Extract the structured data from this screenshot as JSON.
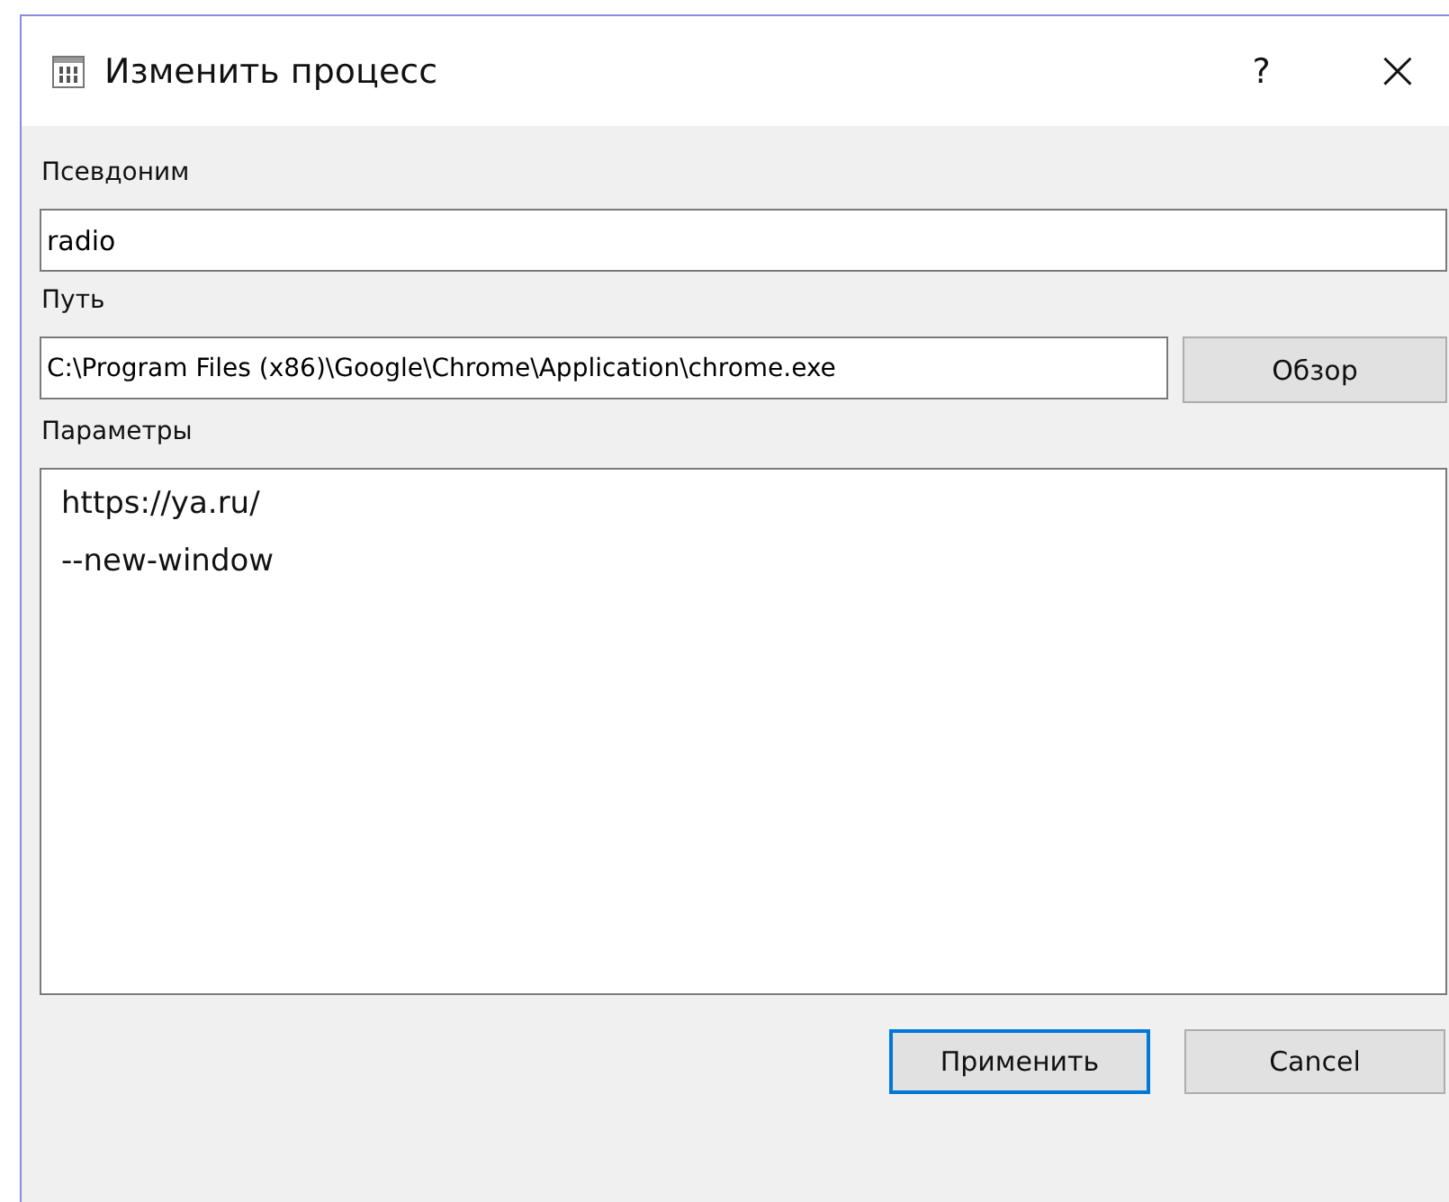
{
  "window": {
    "title": "Изменить процесс",
    "help": "?",
    "close": "×"
  },
  "fields": [
    {
      "kind": "line",
      "label": "Псевдоним",
      "value": "radio"
    },
    {
      "kind": "path",
      "label": "Путь",
      "value": "C:\\Program Files (x86)\\Google\\Chrome\\Application\\chrome.exe",
      "button": "Обзор"
    },
    {
      "kind": "multiline",
      "label": "Параметры",
      "value": "https://ya.ru/\n--new-window"
    }
  ],
  "buttons": [
    {
      "label": "Применить",
      "focused": true
    },
    {
      "label": "Cancel",
      "focused": false
    }
  ]
}
